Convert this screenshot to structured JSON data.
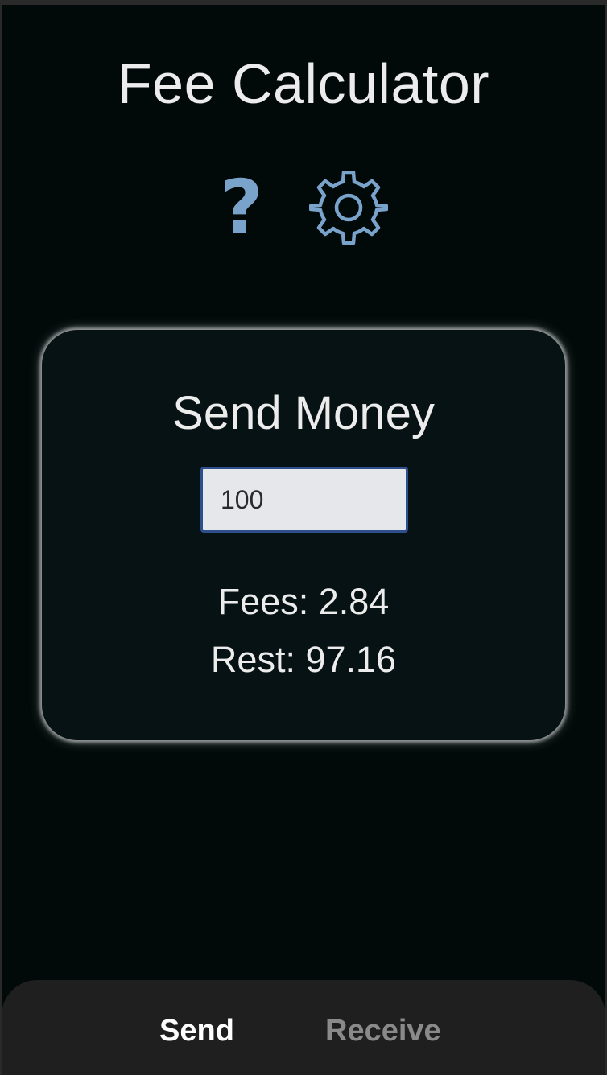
{
  "app": {
    "title": "Fee Calculator"
  },
  "toolbar": {
    "help_icon": "question-mark-icon",
    "settings_icon": "gear-icon",
    "icon_color": "#7aa3cc"
  },
  "card": {
    "title": "Send Money",
    "amount_value": "100",
    "fees_label": "Fees: 2.84",
    "rest_label": "Rest: 97.16"
  },
  "tabs": [
    {
      "label": "Send",
      "active": true
    },
    {
      "label": "Receive",
      "active": false
    }
  ],
  "colors": {
    "background": "#010909",
    "card_background": "#061213",
    "text": "#ececec",
    "tab_bar": "#1f1f1f",
    "tab_active": "#ffffff",
    "tab_inactive": "#8a8a8a",
    "input_border": "#2e4e8c"
  }
}
